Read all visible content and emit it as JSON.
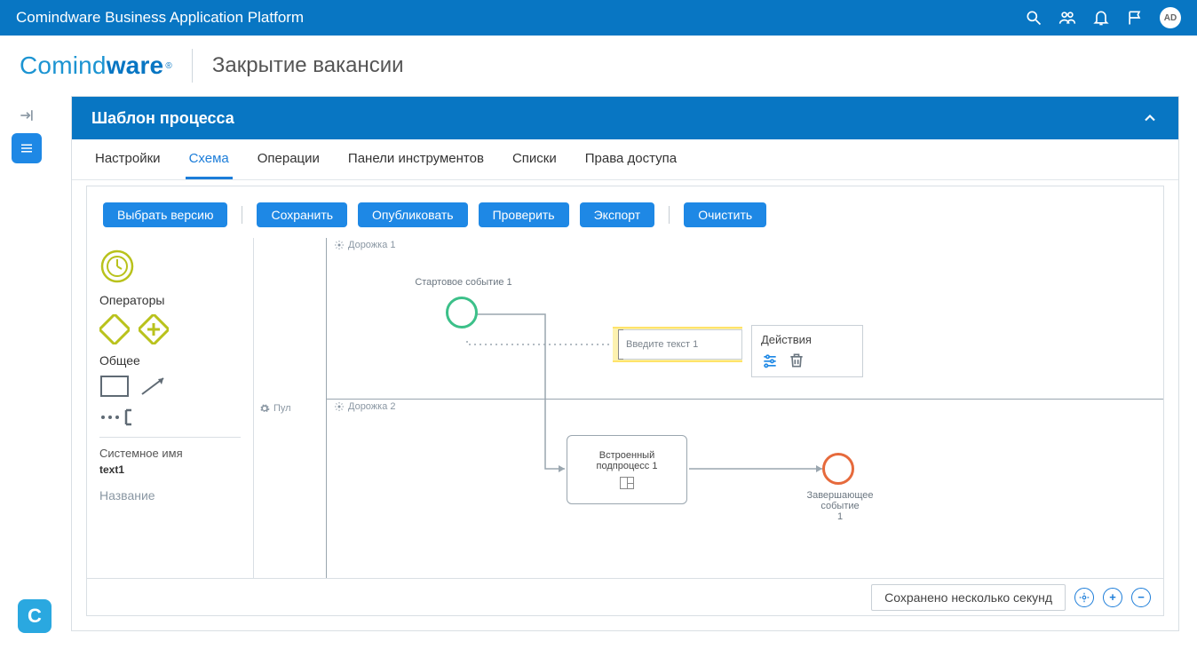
{
  "top": {
    "title": "Comindware Business Application Platform",
    "avatar": "AD"
  },
  "logo": {
    "w1": "Comind",
    "w2": "ware"
  },
  "page_title": "Закрытие вакансии",
  "panel": {
    "title": "Шаблон процесса"
  },
  "tabs": [
    "Настройки",
    "Схема",
    "Операции",
    "Панели инструментов",
    "Списки",
    "Права доступа"
  ],
  "active_tab": 1,
  "buttons": [
    "Выбрать версию",
    "Сохранить",
    "Опубликовать",
    "Проверить",
    "Экспорт",
    "Очистить"
  ],
  "palette": {
    "h1": "Операторы",
    "h2": "Общее",
    "prop1_label": "Системное имя",
    "prop1_value": "text1",
    "prop2_label": "Название"
  },
  "canvas": {
    "pool": "Пул",
    "lane1": "Дорожка 1",
    "lane2": "Дорожка 2",
    "start_label": "Стартовое событие 1",
    "annot_text": "Введите текст 1",
    "task_l1": "Встроенный",
    "task_l2": "подпроцесс 1",
    "end_l1": "Завершающее событие",
    "end_l2": "1",
    "popup_title": "Действия"
  },
  "status": {
    "text": "Сохранено несколько секунд"
  }
}
